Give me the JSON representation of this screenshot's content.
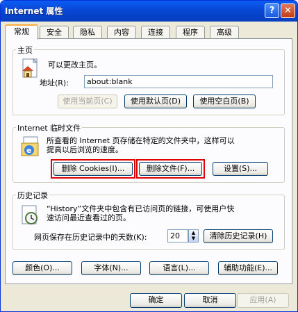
{
  "window": {
    "title": "Internet 属性",
    "help": "?",
    "close": "✕"
  },
  "tabs": [
    "常规",
    "安全",
    "隐私",
    "内容",
    "连接",
    "程序",
    "高级"
  ],
  "home": {
    "legend": "主页",
    "desc": "可以更改主页。",
    "address_label": "地址(R):",
    "address_value": "about:blank",
    "btn_current": "使用当前页(C)",
    "btn_default": "使用默认页(D)",
    "btn_blank": "使用空白页(B)"
  },
  "temp": {
    "legend": "Internet 临时文件",
    "desc_line1": "所查看的 Internet 页存储在特定的文件夹中，这样可以",
    "desc_line2": "提高以后浏览的速度。",
    "btn_cookies": "删除 Cookies(I)...",
    "btn_files": "删除文件(F)...",
    "btn_settings": "设置(S)..."
  },
  "history": {
    "legend": "历史记录",
    "desc_line1": "“History”文件夹中包含有已访问页的链接，可使用户快",
    "desc_line2": "速访问最近查看过的页。",
    "days_label": "网页保存在历史记录中的天数(K):",
    "days_value": "20",
    "btn_clear": "清除历史记录(H)"
  },
  "bottom_row": {
    "colors": "颜色(O)...",
    "fonts": "字体(N)...",
    "languages": "语言(L)...",
    "accessibility": "辅助功能(E)..."
  },
  "dialog": {
    "ok": "确定",
    "cancel": "取消",
    "apply": "应用(A)"
  },
  "colors": {
    "highlight": "#e00000",
    "title_blue": "#0a49d8",
    "dialog_bg": "#ece9d8"
  }
}
